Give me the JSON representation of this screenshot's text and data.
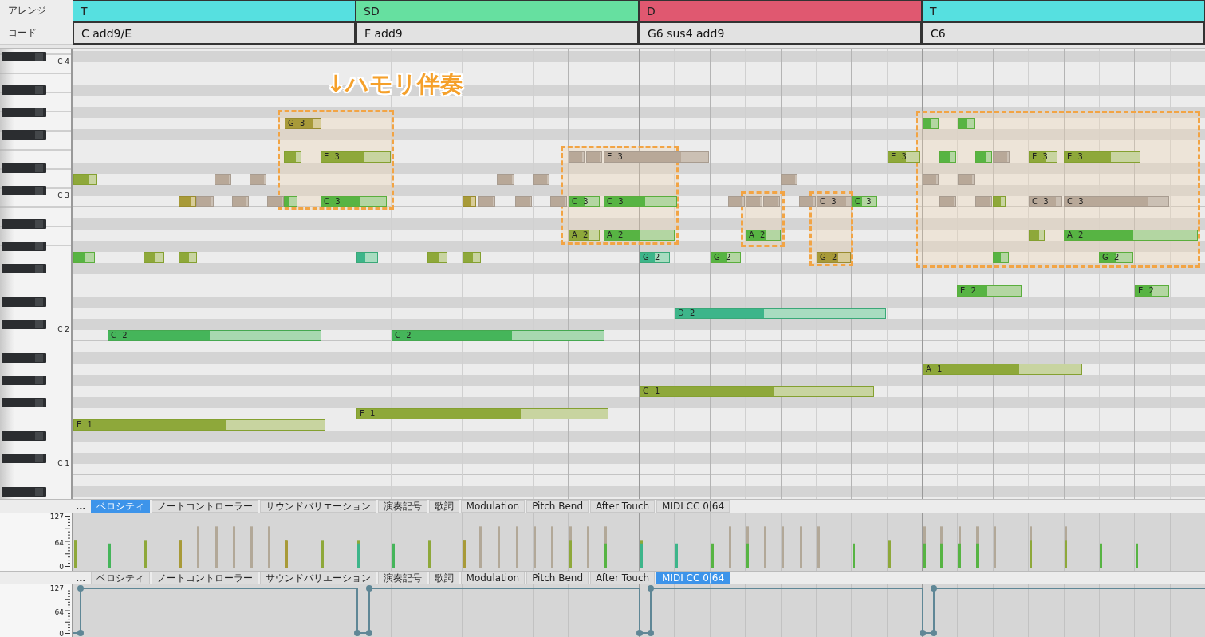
{
  "arrange": {
    "label": "アレンジ",
    "sections": [
      {
        "label": "T",
        "color": "#56e0e0"
      },
      {
        "label": "SD",
        "color": "#66e0a0"
      },
      {
        "label": "D",
        "color": "#e05870"
      },
      {
        "label": "T",
        "color": "#56e0e0"
      }
    ]
  },
  "chord": {
    "label": "コード",
    "cells": [
      "C add9/E",
      "F add9",
      "G6 sus4 add9",
      "C6"
    ]
  },
  "keyboard": {
    "octave_labels": [
      "C 4",
      "C 3",
      "C 2",
      "C 1"
    ]
  },
  "roll": {
    "annotation": "↓ハモリ伴奏",
    "note_labels": [
      "G 3",
      "E 3",
      "E 3",
      "E 3",
      "E 3",
      "E 3",
      "C 3",
      "C 3",
      "C 3",
      "C 3",
      "C 3",
      "C 3",
      "C 3",
      "A 2",
      "A 2",
      "A 2",
      "A 2",
      "G 2",
      "G 2",
      "G 2",
      "G 2",
      "E 2",
      "E 2",
      "D 2",
      "C 2",
      "C 2",
      "A 1",
      "G 1",
      "F 1",
      "E 1"
    ]
  },
  "lanes": [
    {
      "more": "...",
      "axis": [
        "127",
        "64",
        "0"
      ],
      "tabs": [
        {
          "label": "ベロシティ",
          "selected": true
        },
        {
          "label": "ノートコントローラー",
          "selected": false
        },
        {
          "label": "サウンドバリエーション",
          "selected": false
        },
        {
          "label": "演奏記号",
          "selected": false
        },
        {
          "label": "歌詞",
          "selected": false
        },
        {
          "label": "Modulation",
          "selected": false
        },
        {
          "label": "Pitch Bend",
          "selected": false
        },
        {
          "label": "After Touch",
          "selected": false
        },
        {
          "label": "MIDI CC 0|64",
          "selected": false
        }
      ]
    },
    {
      "more": "...",
      "axis": [
        "127",
        "64",
        "0"
      ],
      "tabs": [
        {
          "label": "ベロシティ",
          "selected": false
        },
        {
          "label": "ノートコントローラー",
          "selected": false
        },
        {
          "label": "サウンドバリエーション",
          "selected": false
        },
        {
          "label": "演奏記号",
          "selected": false
        },
        {
          "label": "歌詞",
          "selected": false
        },
        {
          "label": "Modulation",
          "selected": false
        },
        {
          "label": "Pitch Bend",
          "selected": false
        },
        {
          "label": "After Touch",
          "selected": false
        },
        {
          "label": "MIDI CC 0|64",
          "selected": true
        }
      ]
    }
  ]
}
